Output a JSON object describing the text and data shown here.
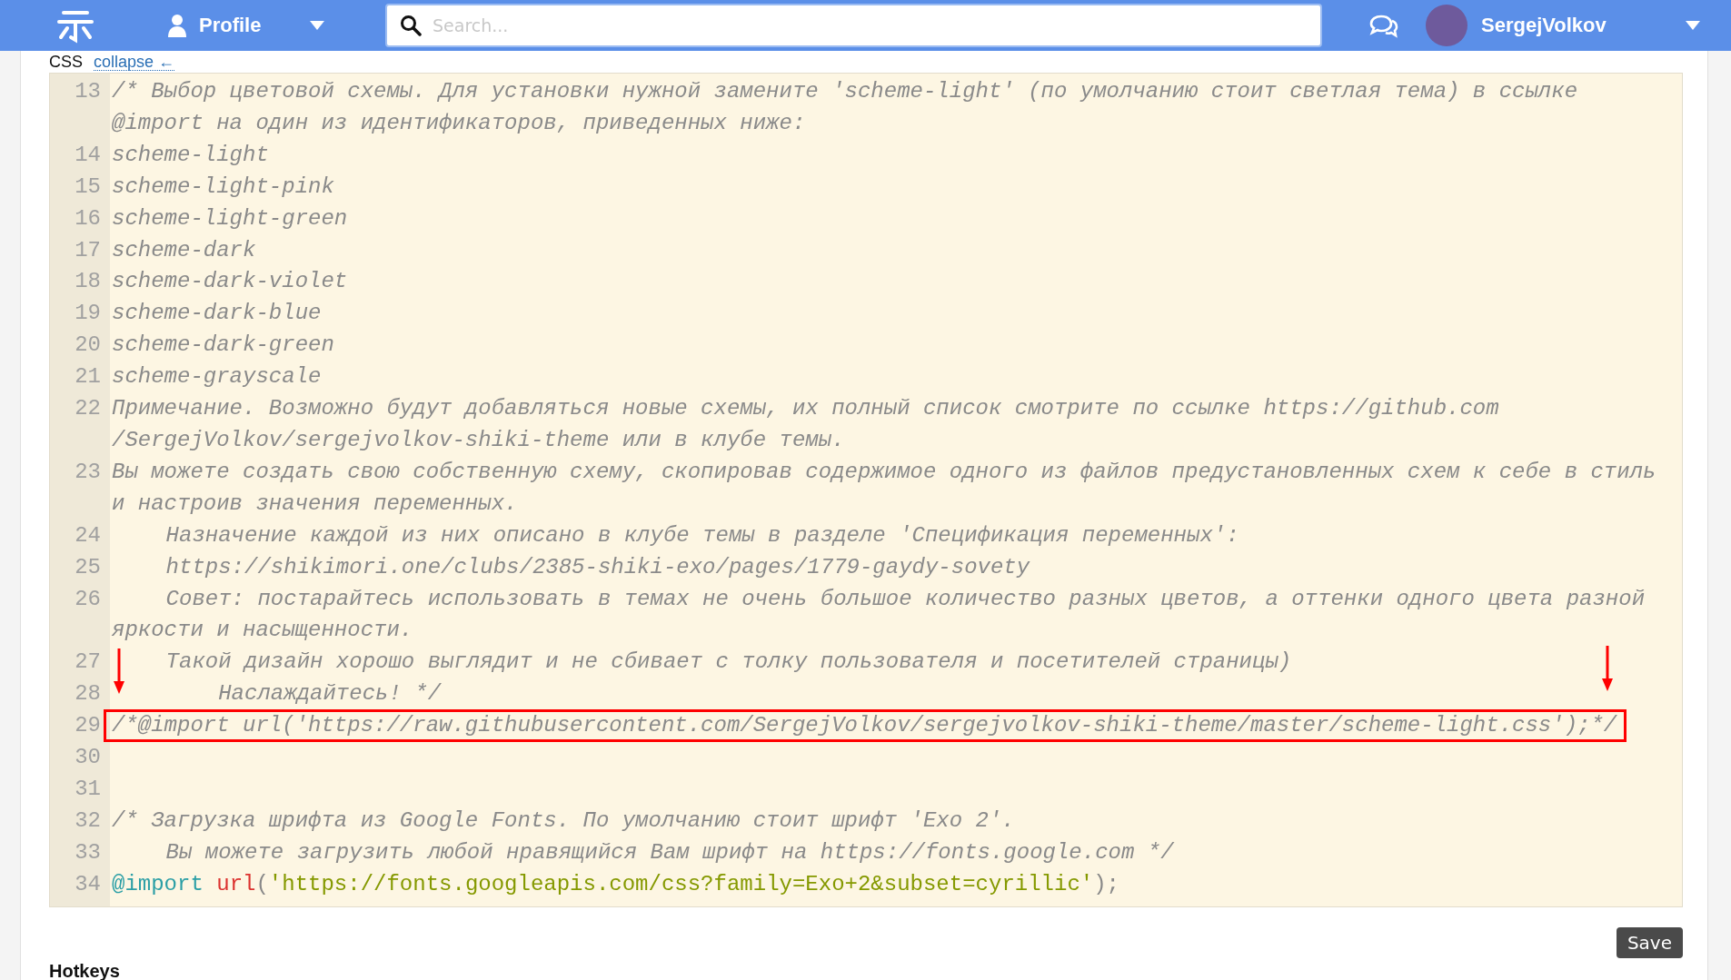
{
  "top_bar": {
    "profile_label": "Profile",
    "search": {
      "placeholder": "Search..."
    },
    "user_name": "SergejVolkov"
  },
  "section": {
    "title": "CSS",
    "toggle_link": "collapse ←"
  },
  "editor": {
    "lines": [
      {
        "number": "13",
        "kind": "comment",
        "highlighted": false,
        "rows": [
          "/* Выбор цветовой схемы. Для установки нужной замените 'scheme-light' (по умолчанию стоит светлая тема) в ссылке",
          "@import на один из идентификаторов, приведенных ниже:"
        ]
      },
      {
        "number": "14",
        "kind": "comment",
        "highlighted": false,
        "rows": [
          "scheme-light"
        ]
      },
      {
        "number": "15",
        "kind": "comment",
        "highlighted": false,
        "rows": [
          "scheme-light-pink"
        ]
      },
      {
        "number": "16",
        "kind": "comment",
        "highlighted": false,
        "rows": [
          "scheme-light-green"
        ]
      },
      {
        "number": "17",
        "kind": "comment",
        "highlighted": false,
        "rows": [
          "scheme-dark"
        ]
      },
      {
        "number": "18",
        "kind": "comment",
        "highlighted": false,
        "rows": [
          "scheme-dark-violet"
        ]
      },
      {
        "number": "19",
        "kind": "comment",
        "highlighted": false,
        "rows": [
          "scheme-dark-blue"
        ]
      },
      {
        "number": "20",
        "kind": "comment",
        "highlighted": false,
        "rows": [
          "scheme-dark-green"
        ]
      },
      {
        "number": "21",
        "kind": "comment",
        "highlighted": false,
        "rows": [
          "scheme-grayscale"
        ]
      },
      {
        "number": "22",
        "kind": "comment",
        "highlighted": false,
        "rows": [
          "Примечание. Возможно будут добавляться новые схемы, их полный список смотрите по ссылке https://github.com",
          "/SergejVolkov/sergejvolkov-shiki-theme или в клубе темы."
        ]
      },
      {
        "number": "23",
        "kind": "comment",
        "highlighted": false,
        "rows": [
          "Вы можете создать свою собственную схему, скопировав содержимое одного из файлов предустановленных схем к себе в стиль",
          "и настроив значения переменных."
        ]
      },
      {
        "number": "24",
        "kind": "comment",
        "highlighted": false,
        "rows": [
          "    Назначение каждой из них описано в клубе темы в разделе 'Спецификация переменных':"
        ]
      },
      {
        "number": "25",
        "kind": "comment",
        "highlighted": false,
        "rows": [
          "    https://shikimori.one/clubs/2385-shiki-exo/pages/1779-gaydy-sovety"
        ]
      },
      {
        "number": "26",
        "kind": "comment",
        "highlighted": false,
        "rows": [
          "    Совет: постарайтесь использовать в темах не очень большое количество разных цветов, а оттенки одного цвета разной",
          "яркости и насыщенности."
        ]
      },
      {
        "number": "27",
        "kind": "comment",
        "highlighted": false,
        "rows": [
          "    Такой дизайн хорошо выглядит и не сбивает с толку пользователя и посетителей страницы)"
        ]
      },
      {
        "number": "28",
        "kind": "comment",
        "highlighted": false,
        "rows": [
          "        Наслаждайтесь! */"
        ]
      },
      {
        "number": "29",
        "kind": "comment",
        "highlighted": true,
        "rows": [
          "/*@import url('https://raw.githubusercontent.com/SergejVolkov/sergejvolkov-shiki-theme/master/scheme-light.css');*/"
        ]
      },
      {
        "number": "30",
        "kind": "blank",
        "highlighted": false
      },
      {
        "number": "31",
        "kind": "blank",
        "highlighted": false
      },
      {
        "number": "32",
        "kind": "comment",
        "highlighted": false,
        "rows": [
          "/* Загрузка шрифта из Google Fonts. По умолчанию стоит шрифт 'Exo 2'."
        ]
      },
      {
        "number": "33",
        "kind": "comment",
        "highlighted": false,
        "rows": [
          "    Вы можете загрузить любой нравящийся Вам шрифт на https://fonts.google.com */"
        ]
      },
      {
        "number": "34",
        "kind": "code",
        "highlighted": false,
        "tokens": [
          {
            "kind": "keyword",
            "text": "@import"
          },
          {
            "kind": "function",
            "text": " url"
          },
          {
            "kind": "punctuation",
            "text": "("
          },
          {
            "kind": "string",
            "text": "'https://fonts.googleapis.com/css?family=Exo+2&subset=cyrillic'"
          },
          {
            "kind": "punctuation",
            "text": ");"
          }
        ]
      }
    ]
  },
  "save_button": "Save",
  "next_section_title": "Hotkeys"
}
